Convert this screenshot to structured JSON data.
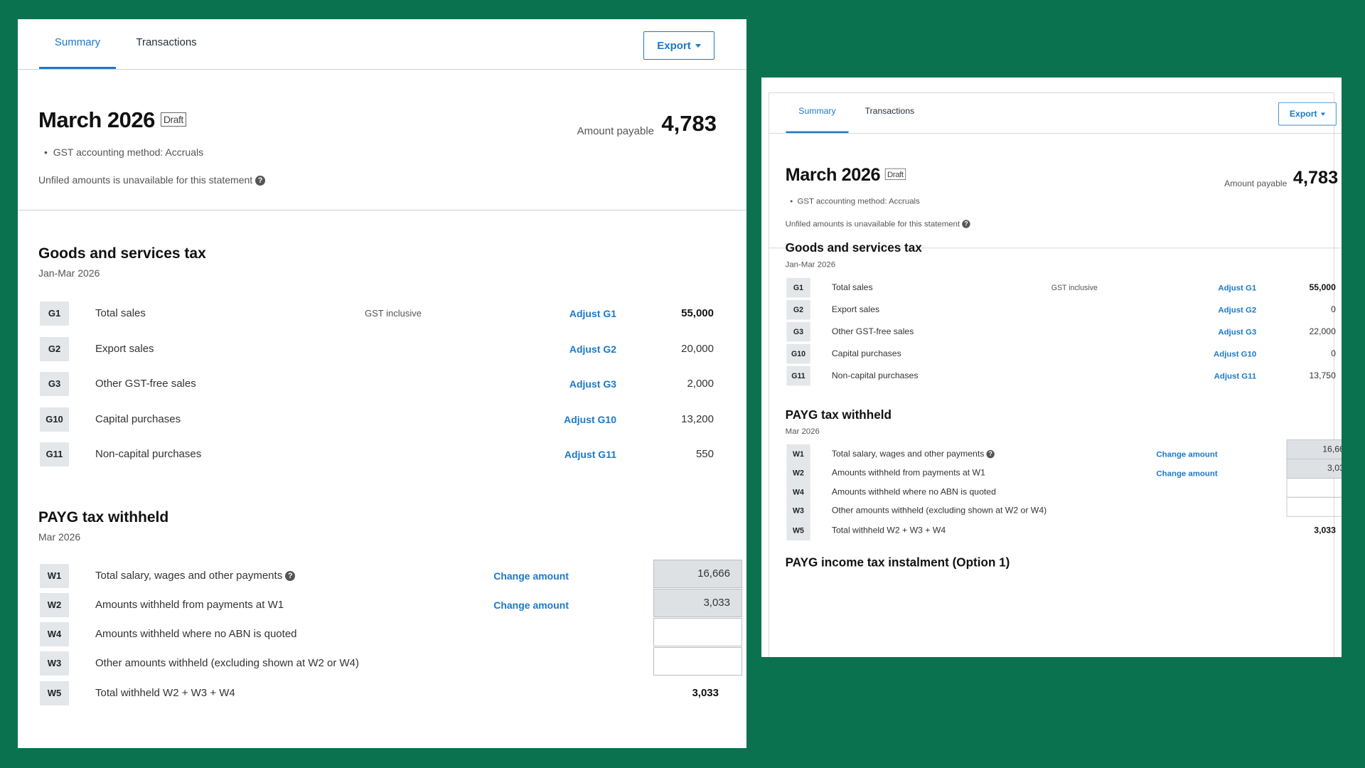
{
  "tabs": {
    "summary": "Summary",
    "transactions": "Transactions"
  },
  "export_label": "Export",
  "statement": {
    "title": "March 2026",
    "status": "Draft",
    "method": "GST accounting method: Accruals",
    "unfiled": "Unfiled amounts is unavailable for this statement",
    "amount_payable_label": "Amount payable",
    "amount_payable": "4,783"
  },
  "gst": {
    "title": "Goods and services tax",
    "period": "Jan-Mar 2026",
    "note": "GST inclusive",
    "rows": [
      {
        "code": "G1",
        "label": "Total sales",
        "adjust": "Adjust G1",
        "value": "55,000"
      },
      {
        "code": "G2",
        "label": "Export sales",
        "adjust": "Adjust G2",
        "value": "20,000"
      },
      {
        "code": "G3",
        "label": "Other GST-free sales",
        "adjust": "Adjust G3",
        "value": "2,000"
      },
      {
        "code": "G10",
        "label": "Capital purchases",
        "adjust": "Adjust G10",
        "value": "13,200"
      },
      {
        "code": "G11",
        "label": "Non-capital purchases",
        "adjust": "Adjust G11",
        "value": "550"
      }
    ],
    "rows_right": [
      "55,000",
      "0",
      "22,000",
      "0",
      "13,750"
    ]
  },
  "payg": {
    "title": "PAYG tax withheld",
    "period": "Mar 2026",
    "change_label": "Change amount",
    "rows": [
      {
        "code": "W1",
        "label": "Total salary, wages and other payments",
        "value": "16,666"
      },
      {
        "code": "W2",
        "label": "Amounts withheld from payments at W1",
        "value": "3,033"
      },
      {
        "code": "W4",
        "label": "Amounts withheld where no ABN is quoted",
        "value": ""
      },
      {
        "code": "W3",
        "label": "Other amounts withheld (excluding shown at W2 or W4)",
        "value": ""
      },
      {
        "code": "W5",
        "label": "Total withheld W2 + W3 + W4",
        "value": "3,033"
      }
    ]
  },
  "next_section_title": "PAYG income tax instalment (Option 1)"
}
